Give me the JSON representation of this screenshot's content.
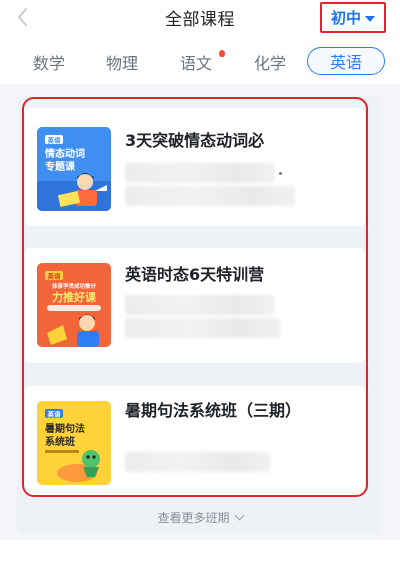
{
  "header": {
    "title": "全部课程",
    "grade_selector": "初中"
  },
  "tabs": [
    {
      "label": "数学",
      "active": false
    },
    {
      "label": "物理",
      "active": false
    },
    {
      "label": "语文",
      "active": false,
      "hot": true
    },
    {
      "label": "化学",
      "active": false
    },
    {
      "label": "英语",
      "active": true
    }
  ],
  "courses": [
    {
      "title": "3天突破情态动词必",
      "cover": {
        "tag": "英语",
        "line1": "情态动词",
        "line2": "专题课",
        "bg": "#3f8ff0"
      }
    },
    {
      "title": "英语时态6天特训营",
      "cover": {
        "tag": "英语",
        "small": "抹茶学员成功推分",
        "line1": "力推好课",
        "bg": "#f2643a"
      }
    },
    {
      "title": "暑期句法系统班（三期）",
      "cover": {
        "tag": "英语",
        "line1": "暑期句法",
        "line2": "系统班",
        "bg": "#ffd23a"
      }
    }
  ],
  "footer": {
    "see_more": "查看更多班期"
  },
  "colors": {
    "accent_blue": "#2f7df6",
    "annotation_red": "#e0252d"
  }
}
